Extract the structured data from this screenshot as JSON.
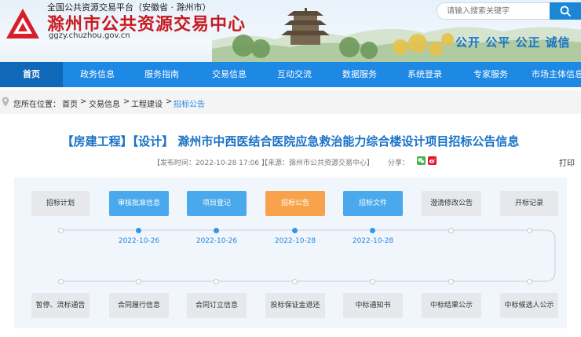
{
  "header": {
    "platform_name": "全国公共资源交易平台（安徽省 · 滁州市）",
    "site_title": "滁州市公共资源交易中心",
    "site_domain": "ggzy.chuzhou.gov.cn",
    "slogan": "公开 公平 公正 诚信",
    "search_placeholder": "请输入搜索关键字",
    "logo_icon": "logo-emblem-icon",
    "search_icon": "search-icon"
  },
  "nav": {
    "items": [
      "首页",
      "政务信息",
      "服务指南",
      "交易信息",
      "互动交流",
      "数据服务",
      "系统登录",
      "专家服务",
      "市场主体信息"
    ],
    "active": "首页"
  },
  "breadcrumb": {
    "prefix": "您所在位置：",
    "items": [
      "首页",
      "交易信息",
      "工程建设",
      "招标公告"
    ],
    "separator": ">",
    "icon": "location-pin-icon"
  },
  "article": {
    "title": "【房建工程】【设计】 滁州市中西医结合医院应急救治能力综合楼设计项目招标公告信息",
    "publish_time": "【发布时间：2022-10-28 17:06 】",
    "source": "【来源：滁州市公共资源交易中心】",
    "share_label": "分享：",
    "print_label": "打印",
    "share_icons": [
      "wechat-icon",
      "weibo-icon"
    ]
  },
  "flow": {
    "top_steps": [
      {
        "label": "招标计划",
        "state": "gray",
        "date": ""
      },
      {
        "label": "审核批准信息",
        "state": "blue",
        "date": "2022-10-26"
      },
      {
        "label": "项目登记",
        "state": "blue",
        "date": "2022-10-26"
      },
      {
        "label": "招标公告",
        "state": "orange",
        "date": "2022-10-28"
      },
      {
        "label": "招标文件",
        "state": "blue",
        "date": "2022-10-28"
      },
      {
        "label": "澄清修改公告",
        "state": "gray",
        "date": ""
      },
      {
        "label": "开标记录",
        "state": "gray",
        "date": ""
      }
    ],
    "bottom_steps": [
      {
        "label": "暂停、流标通告",
        "state": "gray"
      },
      {
        "label": "合同履行信息",
        "state": "gray"
      },
      {
        "label": "合同订立信息",
        "state": "gray"
      },
      {
        "label": "投标保证金退还",
        "state": "gray"
      },
      {
        "label": "中标通知书",
        "state": "gray"
      },
      {
        "label": "中标结果公示",
        "state": "gray"
      },
      {
        "label": "中标候选人公示",
        "state": "gray"
      }
    ],
    "colors": {
      "blue": "#4aa8ec",
      "orange": "#f9a24c",
      "gray": "#e6e8eb",
      "line": "#c8ced6",
      "active_dot": "#2d9ae8"
    }
  }
}
